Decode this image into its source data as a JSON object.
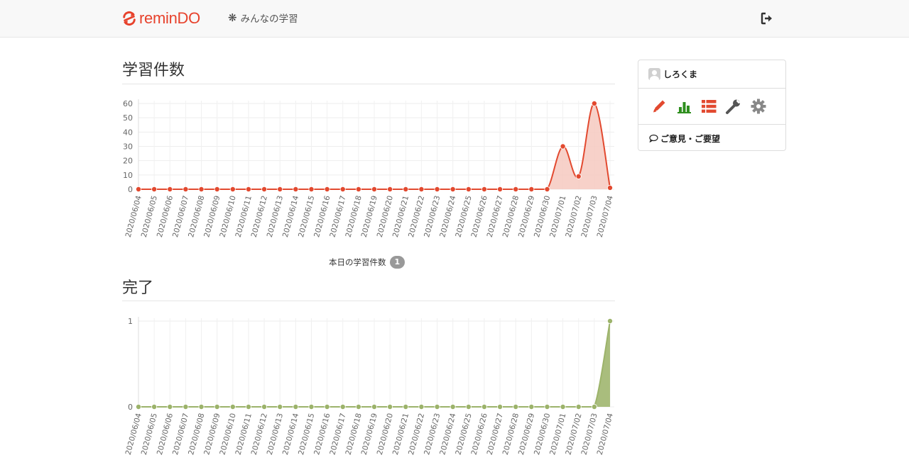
{
  "app": {
    "brand": "reminDO",
    "nav_link": "みんなの学習",
    "brand_color": "#e7422c"
  },
  "study_section": {
    "title": "学習件数",
    "today_label": "本日の学習件数",
    "today_count": "1"
  },
  "done_section": {
    "title": "完了"
  },
  "sidebar": {
    "username": "しろくま",
    "icons": [
      "pencil-icon",
      "bar-chart-icon",
      "list-icon",
      "wrench-icon",
      "gear-icon"
    ],
    "feedback_label": "ご意見・ご要望"
  },
  "chart_data": [
    {
      "type": "area",
      "categories": [
        "2020/06/04",
        "2020/06/05",
        "2020/06/06",
        "2020/06/07",
        "2020/06/08",
        "2020/06/09",
        "2020/06/10",
        "2020/06/11",
        "2020/06/12",
        "2020/06/13",
        "2020/06/14",
        "2020/06/15",
        "2020/06/16",
        "2020/06/17",
        "2020/06/18",
        "2020/06/19",
        "2020/06/20",
        "2020/06/21",
        "2020/06/22",
        "2020/06/23",
        "2020/06/24",
        "2020/06/25",
        "2020/06/26",
        "2020/06/27",
        "2020/06/28",
        "2020/06/29",
        "2020/06/30",
        "2020/07/01",
        "2020/07/02",
        "2020/07/03",
        "2020/07/04"
      ],
      "values": [
        0,
        0,
        0,
        0,
        0,
        0,
        0,
        0,
        0,
        0,
        0,
        0,
        0,
        0,
        0,
        0,
        0,
        0,
        0,
        0,
        0,
        0,
        0,
        0,
        0,
        0,
        0,
        30,
        9,
        60,
        1
      ],
      "yticks": [
        0,
        10,
        20,
        30,
        40,
        50,
        60
      ],
      "ylim": [
        0,
        60
      ],
      "grid": true,
      "line_color": "#e2492f",
      "fill_color": "#f6c9c0"
    },
    {
      "type": "area",
      "categories": [
        "2020/06/04",
        "2020/06/05",
        "2020/06/06",
        "2020/06/07",
        "2020/06/08",
        "2020/06/09",
        "2020/06/10",
        "2020/06/11",
        "2020/06/12",
        "2020/06/13",
        "2020/06/14",
        "2020/06/15",
        "2020/06/16",
        "2020/06/17",
        "2020/06/18",
        "2020/06/19",
        "2020/06/20",
        "2020/06/21",
        "2020/06/22",
        "2020/06/23",
        "2020/06/24",
        "2020/06/25",
        "2020/06/26",
        "2020/06/27",
        "2020/06/28",
        "2020/06/29",
        "2020/06/30",
        "2020/07/01",
        "2020/07/02",
        "2020/07/03",
        "2020/07/04"
      ],
      "values": [
        0,
        0,
        0,
        0,
        0,
        0,
        0,
        0,
        0,
        0,
        0,
        0,
        0,
        0,
        0,
        0,
        0,
        0,
        0,
        0,
        0,
        0,
        0,
        0,
        0,
        0,
        0,
        0,
        0,
        0,
        1
      ],
      "yticks": [
        0,
        1
      ],
      "ylim": [
        0,
        1
      ],
      "grid": true,
      "line_color": "#9cb36a",
      "fill_color": "#a9bd7d"
    }
  ]
}
